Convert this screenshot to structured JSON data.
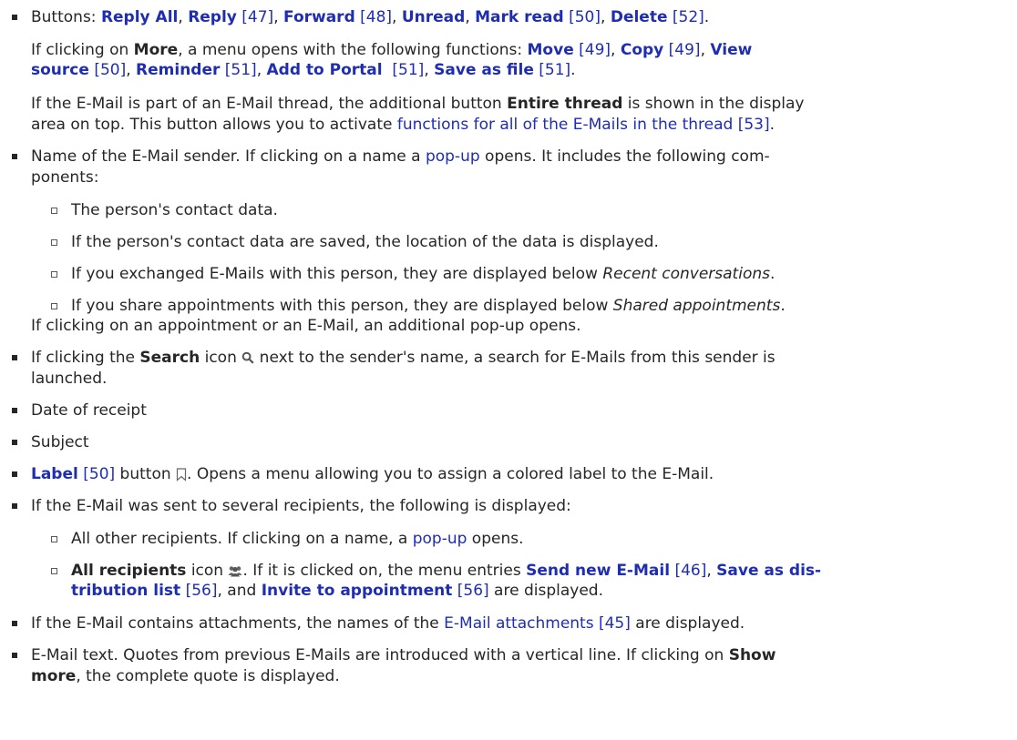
{
  "items": {
    "buttons": {
      "prefix": "Buttons: ",
      "reply_all": "Reply All",
      "reply": "Reply",
      "reply_ref": "[47]",
      "forward": "Forward",
      "forward_ref": "[48]",
      "unread": "Unread",
      "mark_read": "Mark read",
      "mark_read_ref": "[50]",
      "delete": "Delete",
      "delete_ref": "[52]",
      "sep": ", ",
      "end": "."
    },
    "more": {
      "intro_a": "If clicking on ",
      "more": "More",
      "intro_b": ", a menu opens with the following functions: ",
      "move": "Move",
      "move_ref": "[49]",
      "copy": "Copy",
      "copy_ref": "[49]",
      "view_source_a": "View",
      "view_source_b": "source",
      "view_source_ref": "[50]",
      "reminder": "Reminder",
      "reminder_ref": "[51]",
      "add_to_portal": "Add to Portal",
      "add_to_portal_ref": "[51]",
      "save_as_file": "Save as file",
      "save_as_file_ref": "[51]"
    },
    "thread": {
      "text_a": "If the E-Mail is part of an E-Mail thread, the additional button ",
      "entire_thread": "Entire thread",
      "text_b": " is shown in the display",
      "text_c": "area on top. This button allows you to activate ",
      "link": "functions for all of the E-Mails in the thread [53]",
      "text_d": "."
    },
    "sender": {
      "text_a": "Name of the E-Mail sender. If clicking on a name a ",
      "popup": "pop-up",
      "text_b": " opens. It includes the following com-",
      "text_c": "ponents:",
      "sub1": "The person's contact data.",
      "sub2": "If the person's contact data are saved, the location of the data is displayed.",
      "sub3_a": "If you exchanged E-Mails with this person, they are displayed below ",
      "sub3_em": "Recent conversations",
      "sub3_b": ".",
      "sub4_a": "If you share appointments with this person, they are displayed below ",
      "sub4_em": "Shared appointments",
      "sub4_b": ".",
      "after": "If clicking on an appointment or an E-Mail, an additional pop-up opens."
    },
    "search": {
      "text_a": "If clicking the ",
      "search": "Search",
      "text_b": " icon ",
      "text_c": " next to the sender's name, a search for E-Mails from this sender is",
      "text_d": "launched."
    },
    "date": "Date of receipt",
    "subject": "Subject",
    "label": {
      "link": "Label",
      "ref": "[50]",
      "text_a": " button ",
      "text_b": ". Opens a menu allowing you to assign a colored label to the E-Mail."
    },
    "recipients": {
      "text": "If the E-Mail was sent to several recipients, the following is displayed:",
      "sub1_a": "All other recipients. If clicking on a name, a ",
      "sub1_popup": "pop-up",
      "sub1_b": " opens.",
      "sub2_all": "All recipients",
      "sub2_a": " icon ",
      "sub2_b": ". If it is clicked on, the menu entries ",
      "send_new": "Send new E-Mail",
      "send_new_ref": "[46]",
      "save_dist_a": "Save as dis-",
      "save_dist_b": "tribution list",
      "save_dist_ref": "[56]",
      "and": ", and ",
      "invite": "Invite to appointment",
      "invite_ref": "[56]",
      "tail": " are displayed."
    },
    "attachments": {
      "text_a": "If the E-Mail contains attachments, the names of the ",
      "link": "E-Mail attachments [45]",
      "text_b": " are displayed."
    },
    "email_text": {
      "text_a": "E-Mail text. Quotes from previous E-Mails are introduced with a vertical line. If clicking on ",
      "show_more_a": "Show",
      "show_more_b": "more",
      "text_b": ", the complete quote is displayed."
    }
  },
  "colors": {
    "link": "#1f2db0",
    "text": "#262626"
  },
  "icons": [
    "search-icon",
    "bookmark-icon",
    "all-recipients-icon"
  ]
}
